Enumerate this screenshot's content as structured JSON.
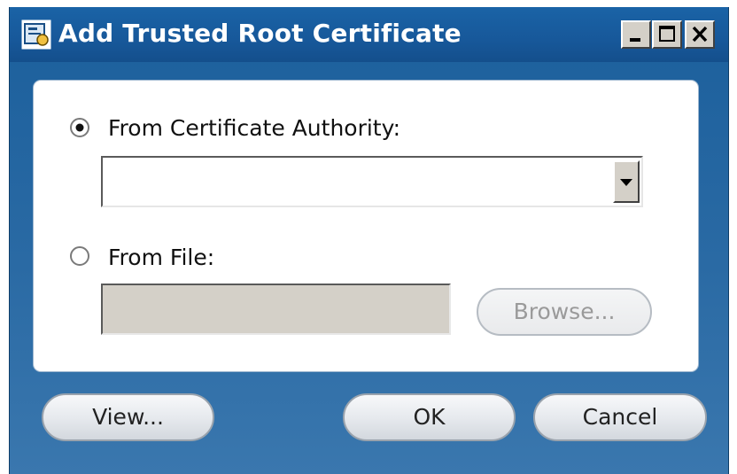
{
  "window": {
    "title": "Add Trusted Root Certificate",
    "icon": "certificate-icon",
    "controls": [
      "minimize-icon",
      "maximize-icon",
      "close-icon"
    ]
  },
  "options": {
    "from_ca": {
      "label": "From Certificate Authority:",
      "selected": true,
      "dropdown_value": ""
    },
    "from_file": {
      "label": "From File:",
      "selected": false,
      "path_value": ""
    }
  },
  "buttons": {
    "browse": "Browse...",
    "view": "View...",
    "ok": "OK",
    "cancel": "Cancel"
  },
  "colors": {
    "frame": "#2a6aa4",
    "titlebar": "#17589a",
    "panel": "#ffffff"
  }
}
